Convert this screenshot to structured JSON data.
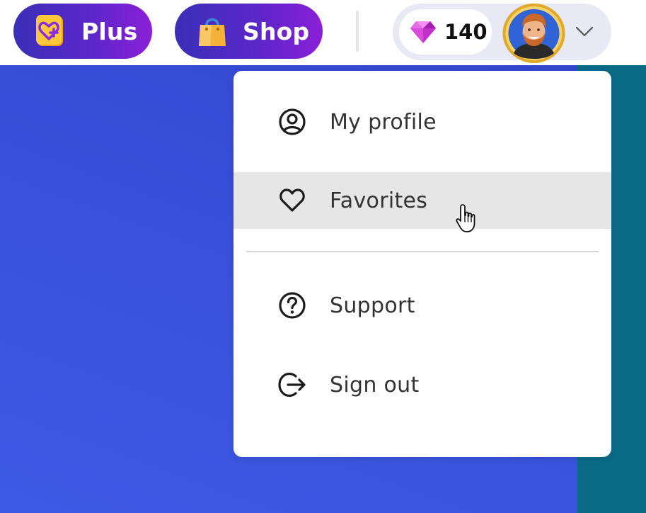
{
  "topbar": {
    "plus": {
      "label": "Plus",
      "icon": "plus-heart-icon"
    },
    "shop": {
      "label": "Shop",
      "icon": "shopping-bag-icon"
    },
    "gems": {
      "count": "140",
      "icon": "gem-icon"
    },
    "avatar": {
      "icon": "avatar"
    },
    "menu_toggle": {
      "icon": "chevron-down-icon"
    }
  },
  "menu": {
    "items": [
      {
        "label": "My profile",
        "icon": "profile-icon"
      },
      {
        "label": "Favorites",
        "icon": "heart-icon",
        "hovered": true
      },
      {
        "label": "Support",
        "icon": "help-icon"
      },
      {
        "label": "Sign out",
        "icon": "sign-out-icon"
      }
    ]
  },
  "colors": {
    "pill_gradient_start": "#3a2fb7",
    "pill_gradient_end": "#8b1fd6",
    "background_blue": "#3a52dc",
    "background_teal": "#0b6b87",
    "menu_hover": "#e6e6e6",
    "account_bg": "#e9e9f6"
  }
}
